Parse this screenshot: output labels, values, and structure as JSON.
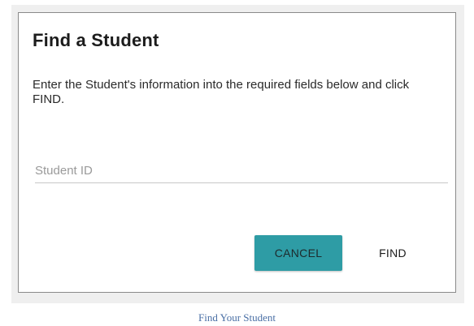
{
  "dialog": {
    "title": "Find a Student",
    "instructions": "Enter the Student's information into the required fields below and click FIND.",
    "student_id_placeholder": "Student ID",
    "cancel_label": "CANCEL",
    "find_label": "FIND"
  },
  "caption": "Find Your Student",
  "colors": {
    "accent": "#2e9ca5",
    "caption": "#4a6fa5"
  }
}
